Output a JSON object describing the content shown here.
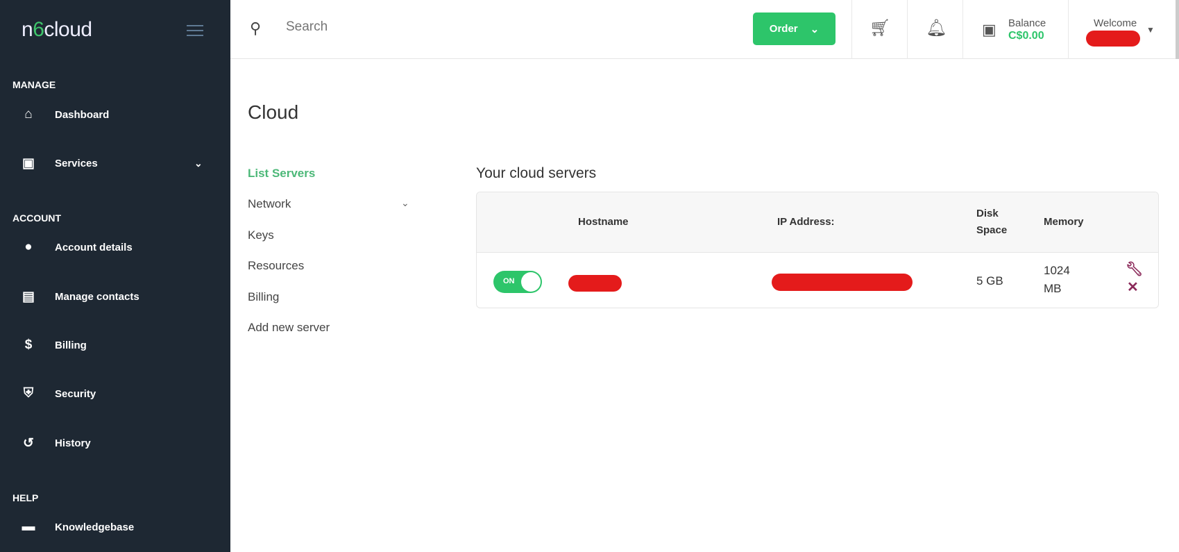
{
  "brand": {
    "logo": "n6cloud"
  },
  "sidebar": {
    "sections": [
      "MANAGE",
      "ACCOUNT",
      "HELP"
    ],
    "items": [
      {
        "label": "Dashboard",
        "icon": "home-icon"
      },
      {
        "label": "Services",
        "icon": "id-card-icon"
      },
      {
        "label": "Account details",
        "icon": "user-icon"
      },
      {
        "label": "Manage contacts",
        "icon": "contacts-icon"
      },
      {
        "label": "Billing",
        "icon": "dollar-icon"
      },
      {
        "label": "Security",
        "icon": "shield-icon"
      },
      {
        "label": "History",
        "icon": "history-icon"
      },
      {
        "label": "Knowledgebase",
        "icon": "book-icon"
      }
    ]
  },
  "header": {
    "search_placeholder": "Search",
    "order_label": "Order",
    "balance_label": "Balance",
    "balance_value": "C$0.00",
    "welcome": "Welcome"
  },
  "page": {
    "title": "Cloud",
    "subnav": [
      "List Servers",
      "Network",
      "Keys",
      "Resources",
      "Billing",
      "Add new server"
    ],
    "section_title": "Your cloud servers"
  },
  "table": {
    "headers": [
      "Hostname",
      "IP Address:",
      "Disk",
      "Space",
      "Memory"
    ],
    "rows": [
      {
        "status": "ON",
        "disk": "5 GB",
        "memory": "1024",
        "memory_unit": "MB"
      }
    ]
  },
  "colors": {
    "accent": "#2dc56a",
    "sidebar": "#1e2833",
    "action": "#8b2a5a"
  }
}
